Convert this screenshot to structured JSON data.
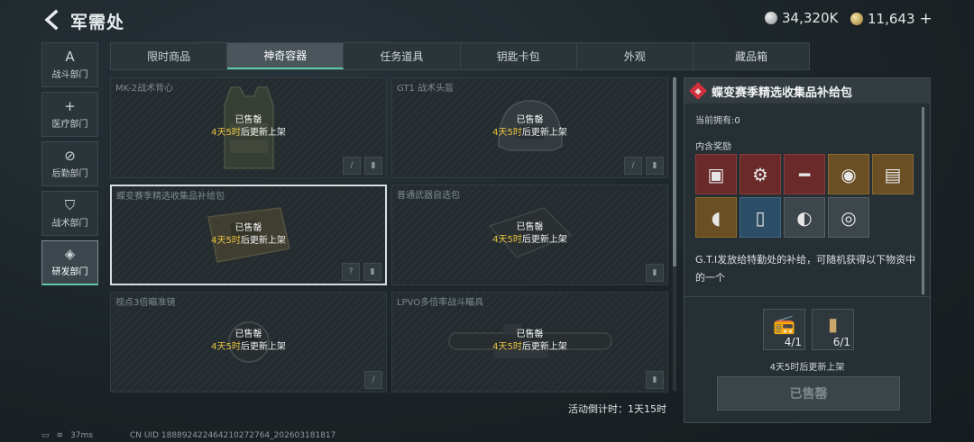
{
  "header": {
    "title": "军需处",
    "currency_silver": "34,320K",
    "currency_gold": "11,643",
    "gold_plus": "+"
  },
  "sidebar": {
    "items": [
      {
        "label": "战斗部门",
        "icon": "A"
      },
      {
        "label": "医疗部门",
        "icon": "+"
      },
      {
        "label": "后勤部门",
        "icon": "⊘"
      },
      {
        "label": "战术部门",
        "icon": "⛉"
      },
      {
        "label": "研发部门",
        "icon": "◈"
      }
    ]
  },
  "tabs": [
    "限时商品",
    "神奇容器",
    "任务道具",
    "钥匙卡包",
    "外观",
    "藏品箱"
  ],
  "cards": [
    {
      "name": "MK-2战术背心",
      "sold": "已售罄",
      "restock_time": "4天5时",
      "restock_suffix": "后更新上架"
    },
    {
      "name": "GT1 战术头盔",
      "sold": "已售罄",
      "restock_time": "4天5时",
      "restock_suffix": "后更新上架"
    },
    {
      "name": "蝶变赛季精选收集品补给包",
      "sold": "已售罄",
      "restock_time": "4天5时",
      "restock_suffix": "后更新上架"
    },
    {
      "name": "普通武器自选包",
      "sold": "已售罄",
      "restock_time": "4天5时",
      "restock_suffix": "后更新上架"
    },
    {
      "name": "视点3倍瞄准镜",
      "sold": "已售罄",
      "restock_time": "4天5时",
      "restock_suffix": "后更新上架"
    },
    {
      "name": "LPVO多倍率战斗瞄具",
      "sold": "已售罄",
      "restock_time": "4天5时",
      "restock_suffix": "后更新上架"
    }
  ],
  "countdown": "活动倒计时：1天15时",
  "panel": {
    "title": "蝶变赛季精选收集品补给包",
    "owned": "当前拥有:0",
    "contains_label": "内含奖励",
    "description": "G.T.I发放给特勤处的补给，可随机获得以下物资中的一个",
    "cost1": "4/1",
    "cost2": "6/1",
    "restock_note": "4天5时后更新上架",
    "buy_label": "已售罄"
  },
  "colors": {
    "accent": "#5cc9a7",
    "restock": "#e9c441",
    "brand_red": "#d1303d"
  },
  "status": {
    "ping": "37ms",
    "uid": "CN UID 18889242246421027276​4_202603181817"
  }
}
